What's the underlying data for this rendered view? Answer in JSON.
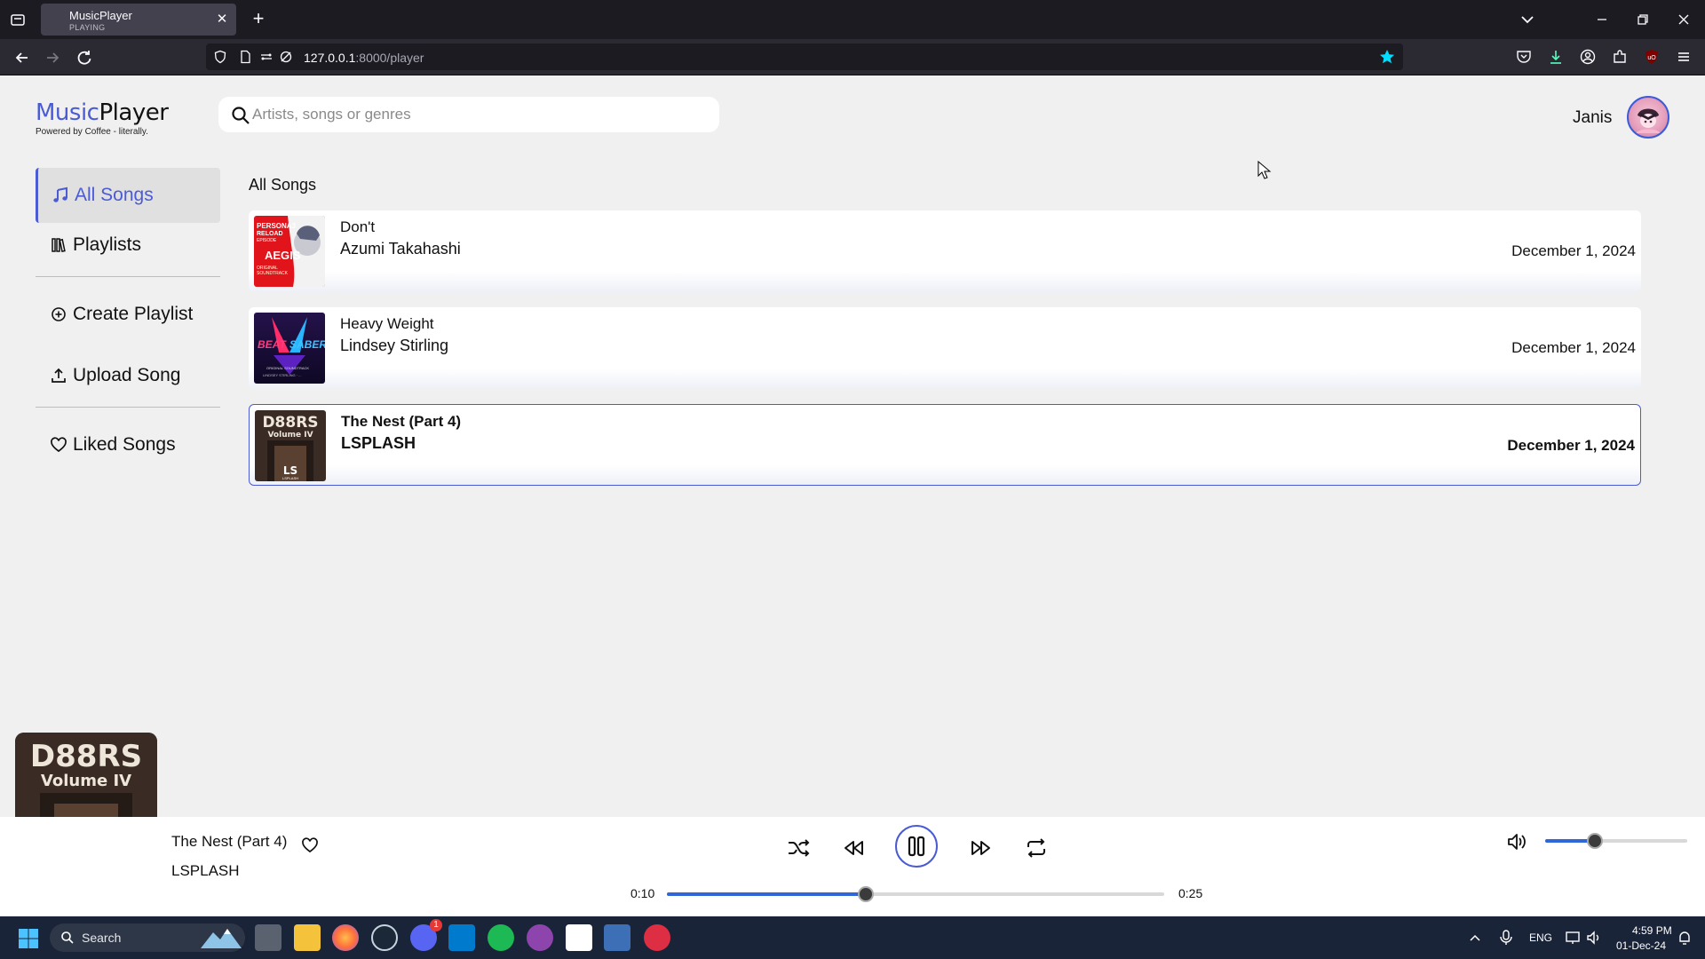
{
  "browser": {
    "tab": {
      "title": "MusicPlayer",
      "subtitle": "PLAYING"
    },
    "url": {
      "host": "127.0.0.1",
      "rest": ":8000/player"
    }
  },
  "app": {
    "logo": {
      "part1": "Music",
      "part2": "Player",
      "tagline": "Powered by Coffee - literally."
    },
    "search": {
      "placeholder": "Artists, songs or genres"
    },
    "user": {
      "name": "Janis"
    }
  },
  "sidebar": {
    "items": [
      {
        "label": "All Songs",
        "icon": "music-note-icon",
        "active": true
      },
      {
        "label": "Playlists",
        "icon": "playlist-icon"
      },
      {
        "label": "Create Playlist",
        "icon": "plus-circle-icon"
      },
      {
        "label": "Upload Song",
        "icon": "upload-icon"
      },
      {
        "label": "Liked Songs",
        "icon": "heart-icon"
      }
    ]
  },
  "main": {
    "title": "All Songs",
    "songs": [
      {
        "title": "Don't",
        "artist": "Azumi Takahashi",
        "date": "December 1, 2024",
        "cover": "persona-cover",
        "selected": false
      },
      {
        "title": "Heavy Weight",
        "artist": "Lindsey Stirling",
        "date": "December 1, 2024",
        "cover": "beat-saber-cover",
        "selected": false
      },
      {
        "title": "The Nest (Part 4)",
        "artist": "LSPLASH",
        "date": "December 1, 2024",
        "cover": "doors-cover",
        "selected": true
      }
    ]
  },
  "player": {
    "title": "The Nest (Part 4)",
    "artist": "LSPLASH",
    "elapsed": "0:10",
    "duration": "0:25",
    "progress": 0.4,
    "volume": 0.35,
    "accent": "#2f67d8"
  },
  "taskbar": {
    "search_label": "Search",
    "lang": "ENG",
    "time": "4:59 PM",
    "date": "01-Dec-24",
    "discord_badge": "1"
  }
}
